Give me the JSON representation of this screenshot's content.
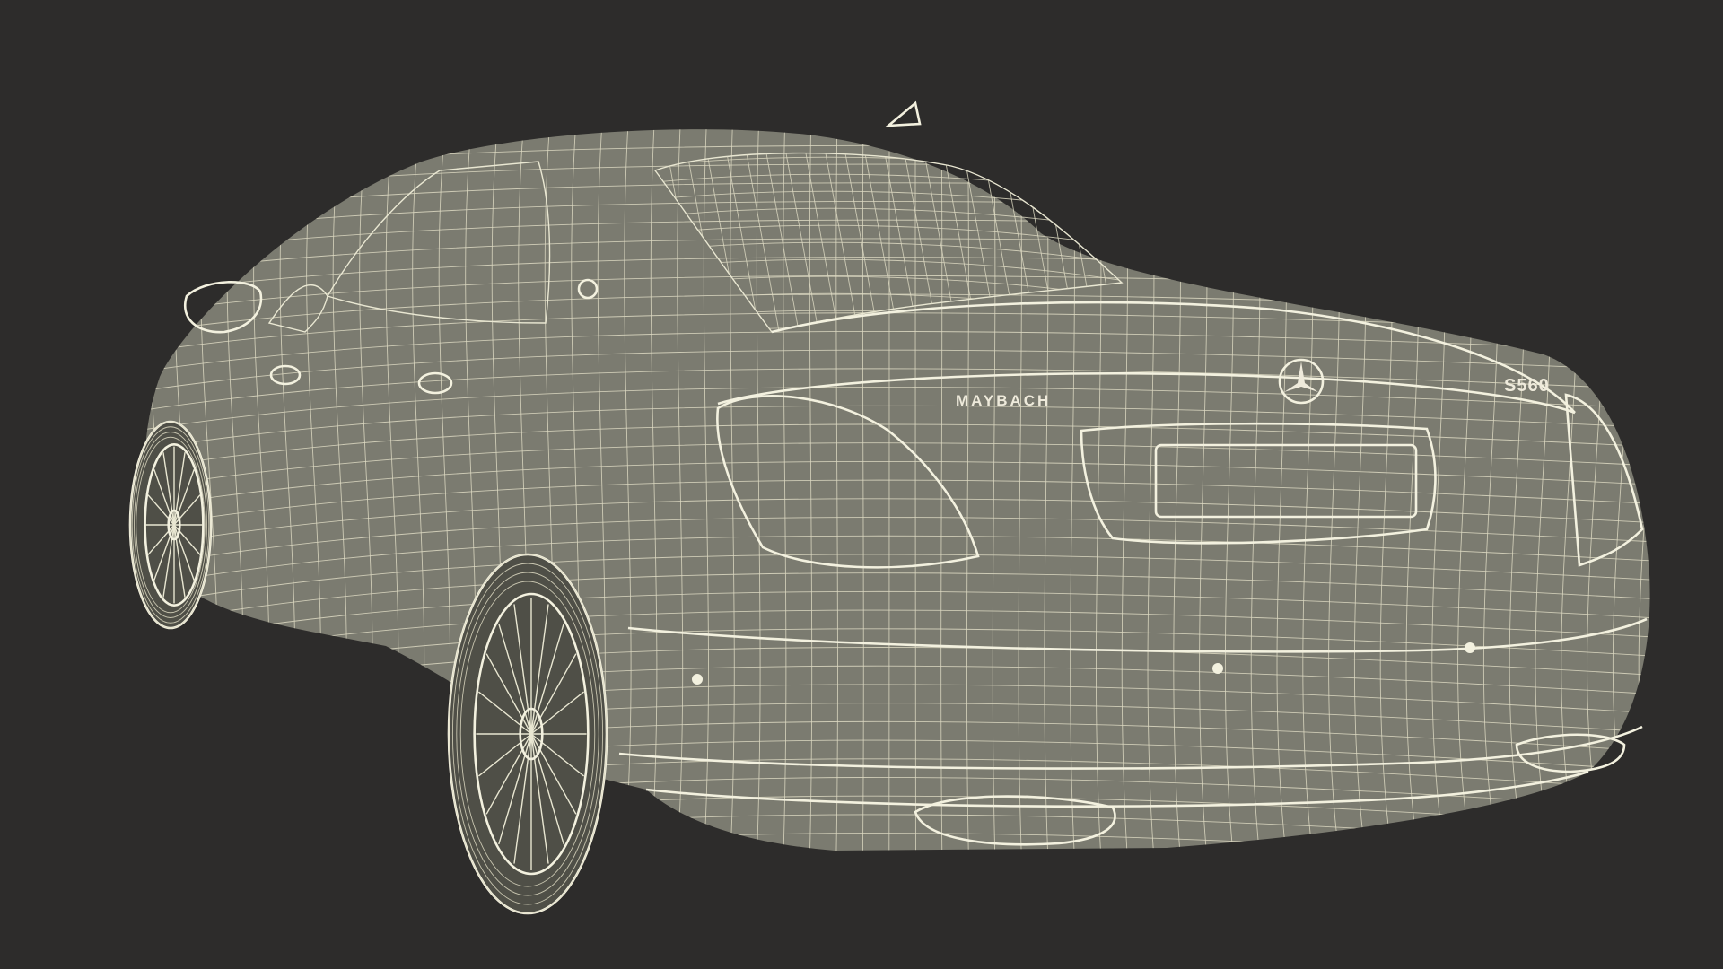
{
  "model": {
    "rear_badge_left": "MAYBACH",
    "rear_badge_right": "S560"
  },
  "colors": {
    "background": "#2d2c2b",
    "wire": "#e9e7d2",
    "surface": "#7b7b70"
  }
}
